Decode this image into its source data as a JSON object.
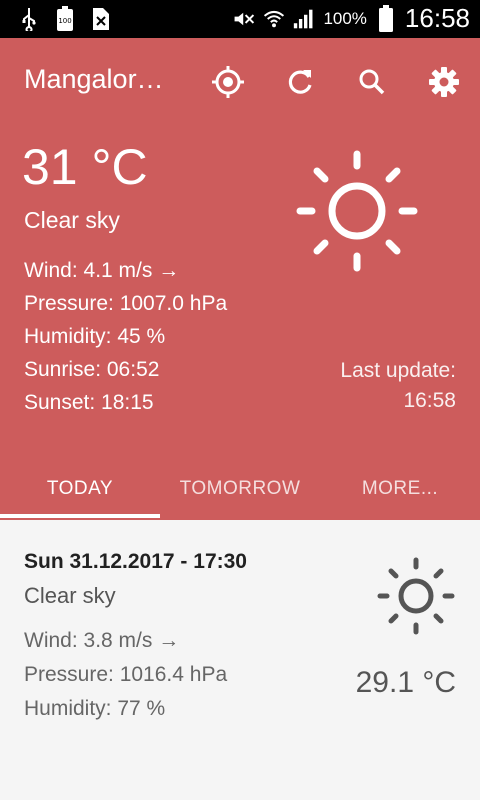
{
  "status_bar": {
    "battery_percent": "100%",
    "time": "16:58",
    "icons": [
      "usb-icon",
      "battery-100-icon",
      "sim-icon",
      "mute-icon",
      "wifi-icon",
      "signal-icon",
      "battery-icon"
    ],
    "sim_badge": "100"
  },
  "toolbar": {
    "title": "Mangalor…",
    "actions": [
      "locate-icon",
      "refresh-icon",
      "search-icon",
      "settings-icon"
    ]
  },
  "current": {
    "temperature": "31 °C",
    "description": "Clear sky",
    "wind": "Wind: 4.1 m/s →",
    "pressure": "Pressure: 1007.0 hPa",
    "humidity": "Humidity: 45 %",
    "sunrise": "Sunrise: 06:52",
    "sunset": "Sunset: 18:15",
    "last_update_label": "Last update:",
    "last_update_time": "16:58",
    "icon": "sun-icon"
  },
  "tabs": [
    {
      "label": "TODAY",
      "active": true
    },
    {
      "label": "TOMORROW",
      "active": false
    },
    {
      "label": "MORE...",
      "active": false
    }
  ],
  "forecast": {
    "datetime": "Sun 31.12.2017 - 17:30",
    "description": "Clear sky",
    "wind": "Wind: 3.8 m/s →",
    "pressure": "Pressure: 1016.4 hPa",
    "humidity": "Humidity: 77 %",
    "temperature": "29.1 °C",
    "icon": "sun-icon"
  },
  "colors": {
    "header": "#cd5c5c",
    "status_bar": "#000000",
    "card_background": "#f5f5f5"
  }
}
